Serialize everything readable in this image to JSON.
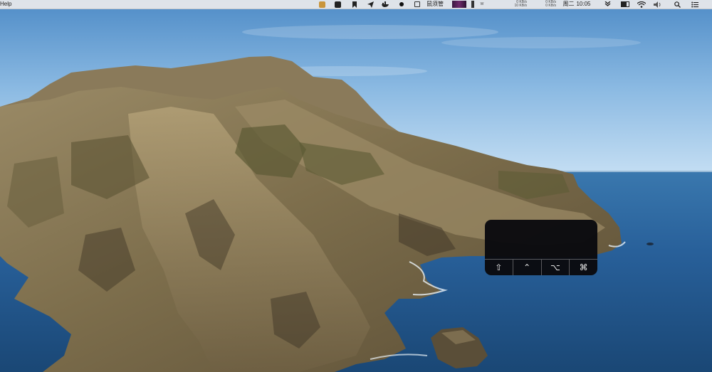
{
  "menubar": {
    "app_menu": "Help",
    "input_method": "鼠须管",
    "network_upload": "0 KB/s",
    "network_download": "10 KB/s",
    "disk_read": "0 KB/s",
    "disk_write": "0 KB/s",
    "cpu_label": "W",
    "day": "周二",
    "time": "10:05",
    "icons": [
      "app-icon",
      "bird-icon",
      "bookmark-icon",
      "paper-plane-icon",
      "docker-icon",
      "dot-icon",
      "input-method-icon",
      "activity-graph-icon",
      "battery-icon",
      "wifi-icon",
      "volume-icon",
      "search-icon",
      "control-center-icon"
    ]
  },
  "keycast": {
    "modifiers": [
      {
        "name": "shift",
        "symbol": "⇧"
      },
      {
        "name": "control",
        "symbol": "⌃"
      },
      {
        "name": "option",
        "symbol": "⌥"
      },
      {
        "name": "command",
        "symbol": "⌘"
      }
    ]
  },
  "colors": {
    "menubar_bg": "#eaeaec",
    "overlay_bg": "#0a0a0e",
    "sea": "#23598e",
    "sky": "#9fc6ea"
  }
}
